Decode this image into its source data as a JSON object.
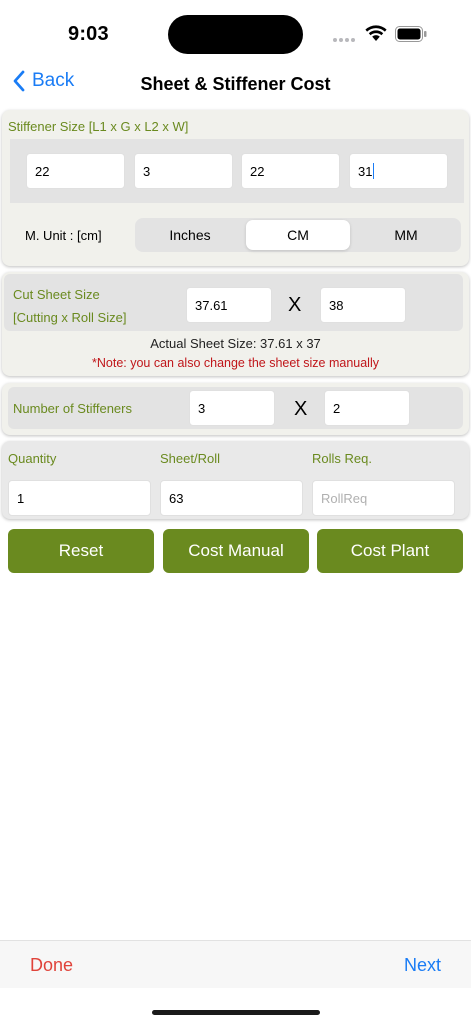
{
  "status": {
    "time": "9:03"
  },
  "nav": {
    "back_label": "Back",
    "title": "Sheet & Stiffener Cost"
  },
  "stiffener": {
    "label": "Stiffener Size [L1 x G x L2 x W]",
    "values": [
      "22",
      "3",
      "22",
      "31"
    ]
  },
  "unit": {
    "label": "M. Unit : [cm]",
    "options": [
      "Inches",
      "CM",
      "MM"
    ],
    "selected": "CM"
  },
  "cut_sheet": {
    "label_line1": "Cut Sheet Size",
    "label_line2": "[Cutting x Roll Size]",
    "cutting": "37.61",
    "separator": "X",
    "roll": "38",
    "actual": "Actual Sheet Size: 37.61 x 37",
    "note": "*Note: you can also change the sheet size manually"
  },
  "stiffeners_count": {
    "label": "Number of Stiffeners",
    "a": "3",
    "separator": "X",
    "b": "2"
  },
  "quantity": {
    "qty_label": "Quantity",
    "qty_value": "1",
    "sheet_label": "Sheet/Roll",
    "sheet_value": "63",
    "rolls_label": "Rolls Req.",
    "rolls_placeholder": "RollReq"
  },
  "buttons": {
    "reset": "Reset",
    "cost_manual": "Cost Manual",
    "cost_plant": "Cost Plant"
  },
  "bottom": {
    "done": "Done",
    "next": "Next"
  },
  "colors": {
    "accent": "#6a8a1f",
    "link": "#1a7cf5",
    "danger": "#e0433a",
    "note": "#c0161a"
  }
}
